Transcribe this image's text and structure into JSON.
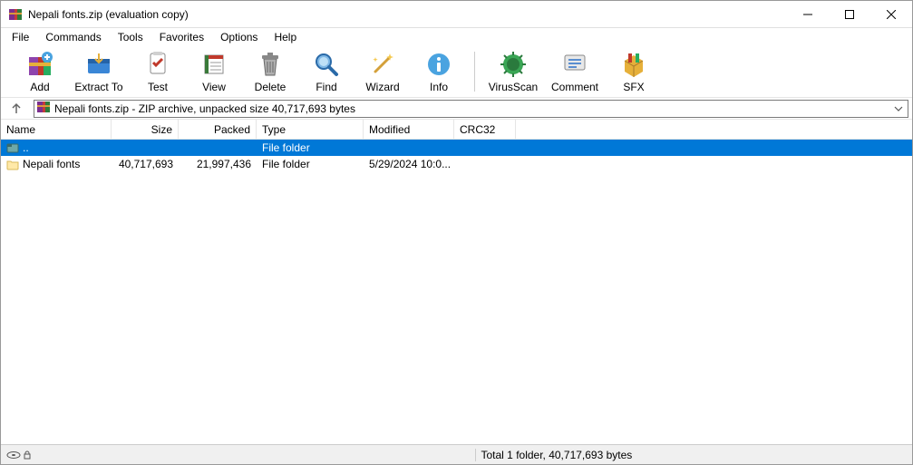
{
  "title": "Nepali fonts.zip (evaluation copy)",
  "menu": [
    "File",
    "Commands",
    "Tools",
    "Favorites",
    "Options",
    "Help"
  ],
  "toolbar": [
    {
      "id": "add",
      "label": "Add"
    },
    {
      "id": "extract",
      "label": "Extract To"
    },
    {
      "id": "test",
      "label": "Test"
    },
    {
      "id": "view",
      "label": "View"
    },
    {
      "id": "delete",
      "label": "Delete"
    },
    {
      "id": "find",
      "label": "Find"
    },
    {
      "id": "wizard",
      "label": "Wizard"
    },
    {
      "id": "info",
      "label": "Info"
    },
    {
      "id": "virus",
      "label": "VirusScan"
    },
    {
      "id": "comment",
      "label": "Comment"
    },
    {
      "id": "sfx",
      "label": "SFX"
    }
  ],
  "address": "Nepali fonts.zip - ZIP archive, unpacked size 40,717,693 bytes",
  "columns": [
    "Name",
    "Size",
    "Packed",
    "Type",
    "Modified",
    "CRC32"
  ],
  "rows": [
    {
      "name": "..",
      "size": "",
      "packed": "",
      "type": "File folder",
      "modified": "",
      "crc": "",
      "selected": true,
      "icon": "updir"
    },
    {
      "name": "Nepali fonts",
      "size": "40,717,693",
      "packed": "21,997,436",
      "type": "File folder",
      "modified": "5/29/2024 10:0...",
      "crc": "",
      "selected": false,
      "icon": "folder"
    }
  ],
  "status": {
    "right": "Total 1 folder, 40,717,693 bytes"
  }
}
